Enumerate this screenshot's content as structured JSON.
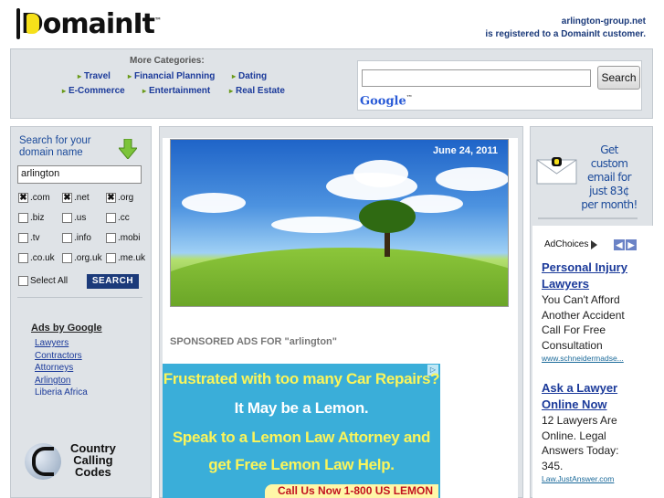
{
  "header": {
    "logo_text": "DomainIt",
    "logo_tm": "™",
    "registered_domain": "arlington-group.net",
    "registered_text": "is registered to a DomainIt customer."
  },
  "categories": {
    "title": "More Categories:",
    "items": [
      "Travel",
      "Financial Planning",
      "Dating",
      "E-Commerce",
      "Entertainment",
      "Real Estate"
    ]
  },
  "search": {
    "value": "",
    "button_label": "Search",
    "google_logo": "Google",
    "google_tm": "™"
  },
  "sidebar": {
    "title_line1": "Search for your",
    "title_line2": "domain name",
    "domain_value": "arlington",
    "tlds": [
      {
        "label": ".com",
        "checked": true
      },
      {
        "label": ".net",
        "checked": true
      },
      {
        "label": ".org",
        "checked": true
      },
      {
        "label": ".biz",
        "checked": false
      },
      {
        "label": ".us",
        "checked": false
      },
      {
        "label": ".cc",
        "checked": false
      },
      {
        "label": ".tv",
        "checked": false
      },
      {
        "label": ".info",
        "checked": false
      },
      {
        "label": ".mobi",
        "checked": false
      },
      {
        "label": ".co.uk",
        "checked": false
      },
      {
        "label": ".org.uk",
        "checked": false
      },
      {
        "label": ".me.uk",
        "checked": false
      }
    ],
    "select_all_label": "Select All",
    "search_button": "SEARCH",
    "ads_title": "Ads by Google",
    "ads_links": [
      "Lawyers",
      "Contractors",
      "Attorneys",
      "Arlington"
    ],
    "ads_static": "Liberia Africa",
    "ccc_line1": "Country",
    "ccc_line2": "Calling",
    "ccc_line3": "Codes"
  },
  "main": {
    "hero_date": "June 24, 2011",
    "sponsored_label": "SPONSORED ADS FOR \"arlington\"",
    "banner": {
      "line1": "Frustrated with too many Car Repairs?",
      "line2": "It May be a Lemon.",
      "line3": "Speak to a Lemon Law Attorney and",
      "line4": "get Free Lemon Law Help.",
      "call_text": "Call Us Now 1-800 US LEMON"
    }
  },
  "right": {
    "promo_text": "Get custom email for just 83¢ per month!",
    "adchoices_label": "AdChoices",
    "ads": [
      {
        "headline": "Personal Injury Lawyers",
        "body": "You Can't Afford Another Accident Call For Free Consultation",
        "url": "www.schneidermadse..."
      },
      {
        "headline": "Ask a Lawyer Online Now",
        "body": "12 Lawyers Are Online. Legal Answers Today: 345.",
        "url": "Law.JustAnswer.com"
      }
    ]
  },
  "colors": {
    "link_blue": "#1b3a9a",
    "panel_gray": "#dfe3e7",
    "navy_button": "#1b3a7a",
    "banner_blue": "#3aaed9",
    "banner_yellow": "#fbf55a"
  }
}
